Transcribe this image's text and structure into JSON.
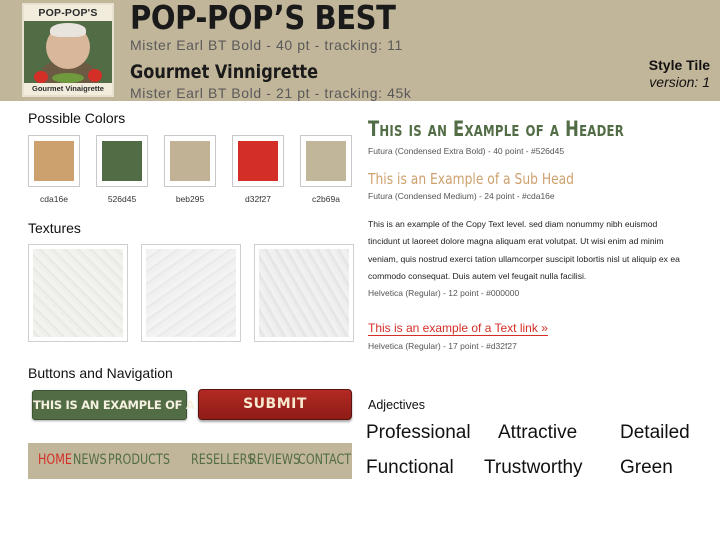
{
  "header": {
    "logo_top": "POP-POP'S BEST",
    "logo_bottom": "Gourmet Vinaigrette",
    "title": "POP-POP’S BEST",
    "title_spec": "Mister Earl BT Bold - 40 pt - tracking: 11",
    "subtitle": "Gourmet Vinnigrette",
    "subtitle_spec": "Mister Earl BT Bold - 21 pt - tracking: 45k",
    "tile_label": "Style Tile",
    "tile_version": "version: 1"
  },
  "colors": {
    "heading": "Possible Colors",
    "swatches": [
      {
        "hex": "#cda16e",
        "label": "cda16e"
      },
      {
        "hex": "#526d45",
        "label": "526d45"
      },
      {
        "hex": "#c2b295",
        "label": "beb295"
      },
      {
        "hex": "#d32f27",
        "label": "d32f27"
      },
      {
        "hex": "#c2b69a",
        "label": "c2b69a"
      }
    ]
  },
  "textures": {
    "heading": "Textures"
  },
  "buttons": {
    "heading": "Buttons and Navigation",
    "example_label": "THIS IS AN EXAMPLE OF A BUTTON",
    "submit_label": "SUBMIT"
  },
  "nav": {
    "items": [
      "HOME",
      "NEWS",
      "PRODUCTS",
      "RESELLERS",
      "REVIEWS",
      "CONTACT"
    ],
    "active": "HOME"
  },
  "typography": {
    "header_text": "This is an Example of a Header",
    "header_spec": "Futura (Condensed Extra Bold) - 40 point - #526d45",
    "sub_text": "This is an Example of a Sub Head",
    "sub_spec": "Futura (Condensed Medium) - 24 point - #cda16e",
    "copy_text": "This is an example of the Copy Text level. sed diam nonummy nibh euismod tincidunt ut laoreet dolore magna aliquam erat volutpat. Ut wisi enim ad minim veniam, quis nostrud exerci tation ullamcorper suscipit lobortis nisl ut aliquip ex ea commodo consequat. Duis autem vel feugait nulla facilisi.",
    "copy_spec": "Helvetica (Regular) - 12 point - #000000",
    "link_text": "This is an example of a Text link »",
    "link_spec": "Helvetica (Regular) - 17 point - #d32f27"
  },
  "adjectives": {
    "heading": "Adjectives",
    "words": [
      "Professional",
      "Attractive",
      "Detailed",
      "Functional",
      "Trustworthy",
      "Green"
    ]
  }
}
